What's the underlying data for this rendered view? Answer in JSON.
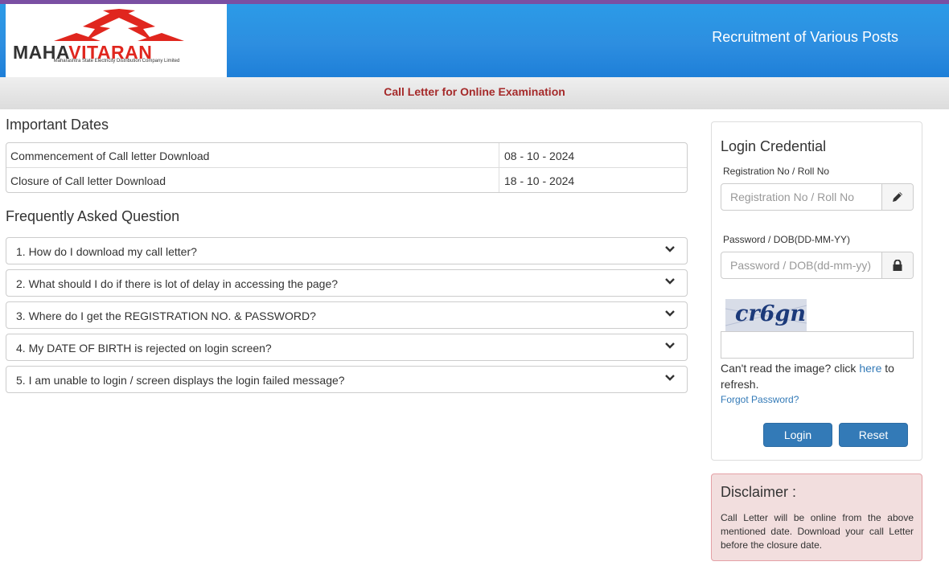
{
  "header": {
    "logo_text_a": "MAHA",
    "logo_text_b": "VITARAN",
    "logo_subtitle": "Maharashtra State Electricity Distribution Company Limited",
    "title": "Recruitment of Various Posts"
  },
  "subbar": {
    "title": "Call Letter for Online Examination"
  },
  "important_dates": {
    "title": "Important Dates",
    "rows": [
      {
        "label": "Commencement of Call letter Download",
        "value": "08 - 10 - 2024"
      },
      {
        "label": "Closure of Call letter Download",
        "value": "18 - 10 - 2024"
      }
    ]
  },
  "faq": {
    "title": "Frequently Asked Question",
    "items": [
      "1. How do I download my call letter?",
      "2. What should I do if there is lot of delay in accessing the page?",
      "3. Where do I get the REGISTRATION NO. & PASSWORD?",
      "4. My DATE OF BIRTH is rejected on login screen?",
      "5. I am unable to login / screen displays the login failed message?"
    ]
  },
  "login": {
    "title": "Login Credential",
    "reg_label": "Registration No / Roll No",
    "reg_placeholder": "Registration No / Roll No",
    "pwd_label": "Password / DOB(DD-MM-YY)",
    "pwd_placeholder": "Password / DOB(dd-mm-yy)",
    "captcha_text": "cr6gn",
    "captcha_help_before": "Can't read the image? click ",
    "captcha_help_link": "here",
    "captcha_help_after": " to refresh.",
    "forgot": "Forgot Password?",
    "login_btn": "Login",
    "reset_btn": "Reset"
  },
  "disclaimer": {
    "title": "Disclaimer :",
    "text": "Call Letter will be online from the above mentioned date. Download your call Letter before the closure date."
  },
  "colors": {
    "header_blue": "#2d8ee0",
    "accent_red": "#a52a2a",
    "button_blue": "#337ab7",
    "disclaimer_bg": "#f2dede"
  },
  "icons": [
    "lightning-logo-icon",
    "pencil-icon",
    "lock-icon",
    "chevron-down-icon"
  ]
}
